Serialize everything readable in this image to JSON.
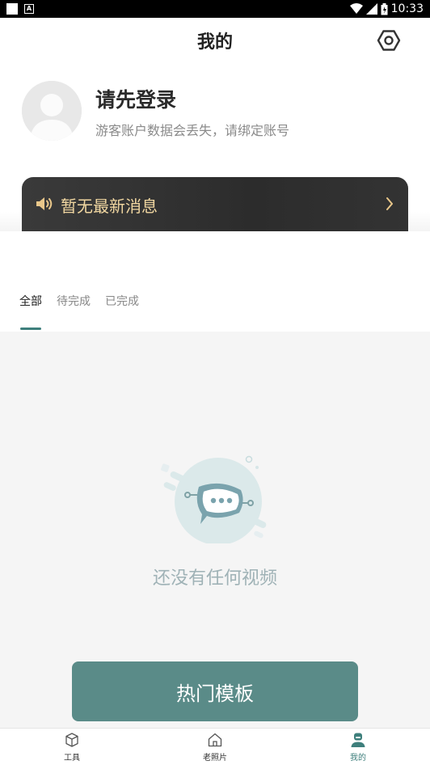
{
  "status_bar": {
    "time": "10:33",
    "left_icon_label": "A"
  },
  "header": {
    "title": "我的",
    "settings_icon": "settings-hex-icon"
  },
  "profile": {
    "title": "请先登录",
    "subtitle": "游客账户数据会丢失，请绑定账号"
  },
  "banner": {
    "text": "暂无最新消息"
  },
  "tabs": [
    {
      "label": "全部",
      "active": true
    },
    {
      "label": "待完成",
      "active": false
    },
    {
      "label": "已完成",
      "active": false
    }
  ],
  "empty_state": {
    "text": "还没有任何视频"
  },
  "hot_button": {
    "label": "热门模板"
  },
  "bottom_nav": [
    {
      "label": "工具",
      "icon": "cube-icon",
      "active": false
    },
    {
      "label": "老照片",
      "icon": "home-icon",
      "active": false
    },
    {
      "label": "我的",
      "icon": "user-icon",
      "active": true
    }
  ],
  "colors": {
    "accent": "#3e7f7c",
    "button": "#5a8b88",
    "banner_text": "#f1d7a1"
  }
}
